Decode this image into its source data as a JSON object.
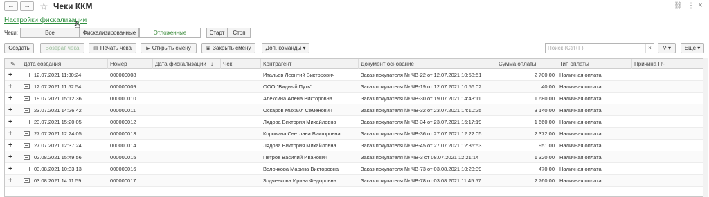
{
  "window": {
    "title": "Чеки ККМ",
    "back": "←",
    "forward": "→",
    "star": "☆",
    "link_icon": "⛓",
    "more_icon": "⋮",
    "close_icon": "×"
  },
  "settings_link": "Настройки фискализации",
  "filter": {
    "label": "Чеки:",
    "options": [
      "Все",
      "Фискализированные",
      "Отложенные"
    ],
    "start": "Старт",
    "stop": "Стоп"
  },
  "toolbar": {
    "create": "Создать",
    "return": "Возврат чека",
    "print": "Печать чека",
    "open_shift": "Открыть смену",
    "close_shift": "Закрыть смену",
    "more_commands": "Доп. команды",
    "search_placeholder": "Поиск (Ctrl+F)",
    "more": "Еще"
  },
  "table": {
    "columns": [
      "Дата создания",
      "Номер",
      "Дата фискализации",
      "Чек",
      "Контрагент",
      "Документ основание",
      "Сумма оплаты",
      "Тип оплаты",
      "Причина ПЧ"
    ],
    "rows": [
      {
        "date": "12.07.2021 11:30:24",
        "num": "000000008",
        "party": "Итальев Леонтий Викторович",
        "doc": "Заказ покупателя № ЧВ-22 от 12.07.2021 10:58:51",
        "sum": "2 700,00",
        "pay": "Наличная оплата"
      },
      {
        "date": "12.07.2021 11:52:54",
        "num": "000000009",
        "party": "ООО \"Видный Путь\"",
        "doc": "Заказ покупателя № ЧВ-19 от 12.07.2021 10:56:02",
        "sum": "40,00",
        "pay": "Наличная оплата"
      },
      {
        "date": "19.07.2021 15:12:36",
        "num": "000000010",
        "party": "Алексина Алена Викторовна",
        "doc": "Заказ покупателя № ЧВ-30 от 19.07.2021 14:43:11",
        "sum": "1 680,00",
        "pay": "Наличная оплата"
      },
      {
        "date": "23.07.2021 14:26:42",
        "num": "000000011",
        "party": "Оскаров Михаил Семенович",
        "doc": "Заказ покупателя № ЧВ-32 от 23.07.2021 14:10:25",
        "sum": "3 140,00",
        "pay": "Наличная оплата"
      },
      {
        "date": "23.07.2021 15:20:05",
        "num": "000000012",
        "party": "Лядова Виктория Михайловна",
        "doc": "Заказ покупателя № ЧВ-34 от 23.07.2021 15:17:19",
        "sum": "1 660,00",
        "pay": "Наличная оплата"
      },
      {
        "date": "27.07.2021 12:24:05",
        "num": "000000013",
        "party": "Коровина Светлана Викторовна",
        "doc": "Заказ покупателя № ЧВ-36 от 27.07.2021 12:22:05",
        "sum": "2 372,00",
        "pay": "Наличная оплата"
      },
      {
        "date": "27.07.2021 12:37:24",
        "num": "000000014",
        "party": "Лядова Виктория Михайловна",
        "doc": "Заказ покупателя № ЧВ-45 от 27.07.2021 12:35:53",
        "sum": "951,00",
        "pay": "Наличная оплата"
      },
      {
        "date": "02.08.2021 15:49:56",
        "num": "000000015",
        "party": "Петров Василий Иванович",
        "doc": "Заказ покупателя № ЧВ-3 от 08.07.2021 12:21:14",
        "sum": "1 320,00",
        "pay": "Наличная оплата"
      },
      {
        "date": "03.08.2021 10:33:13",
        "num": "000000016",
        "party": "Волочкова Марина Викторовна",
        "doc": "Заказ покупателя № ЧВ-73 от 03.08.2021 10:23:39",
        "sum": "470,00",
        "pay": "Наличная оплата"
      },
      {
        "date": "03.08.2021 14:11:59",
        "num": "000000017",
        "party": "Зодченкова Ирина Федоровна",
        "doc": "Заказ покупателя № ЧВ-78 от 03.08.2021 11:45:57",
        "sum": "2 760,00",
        "pay": "Наличная оплата"
      }
    ]
  }
}
